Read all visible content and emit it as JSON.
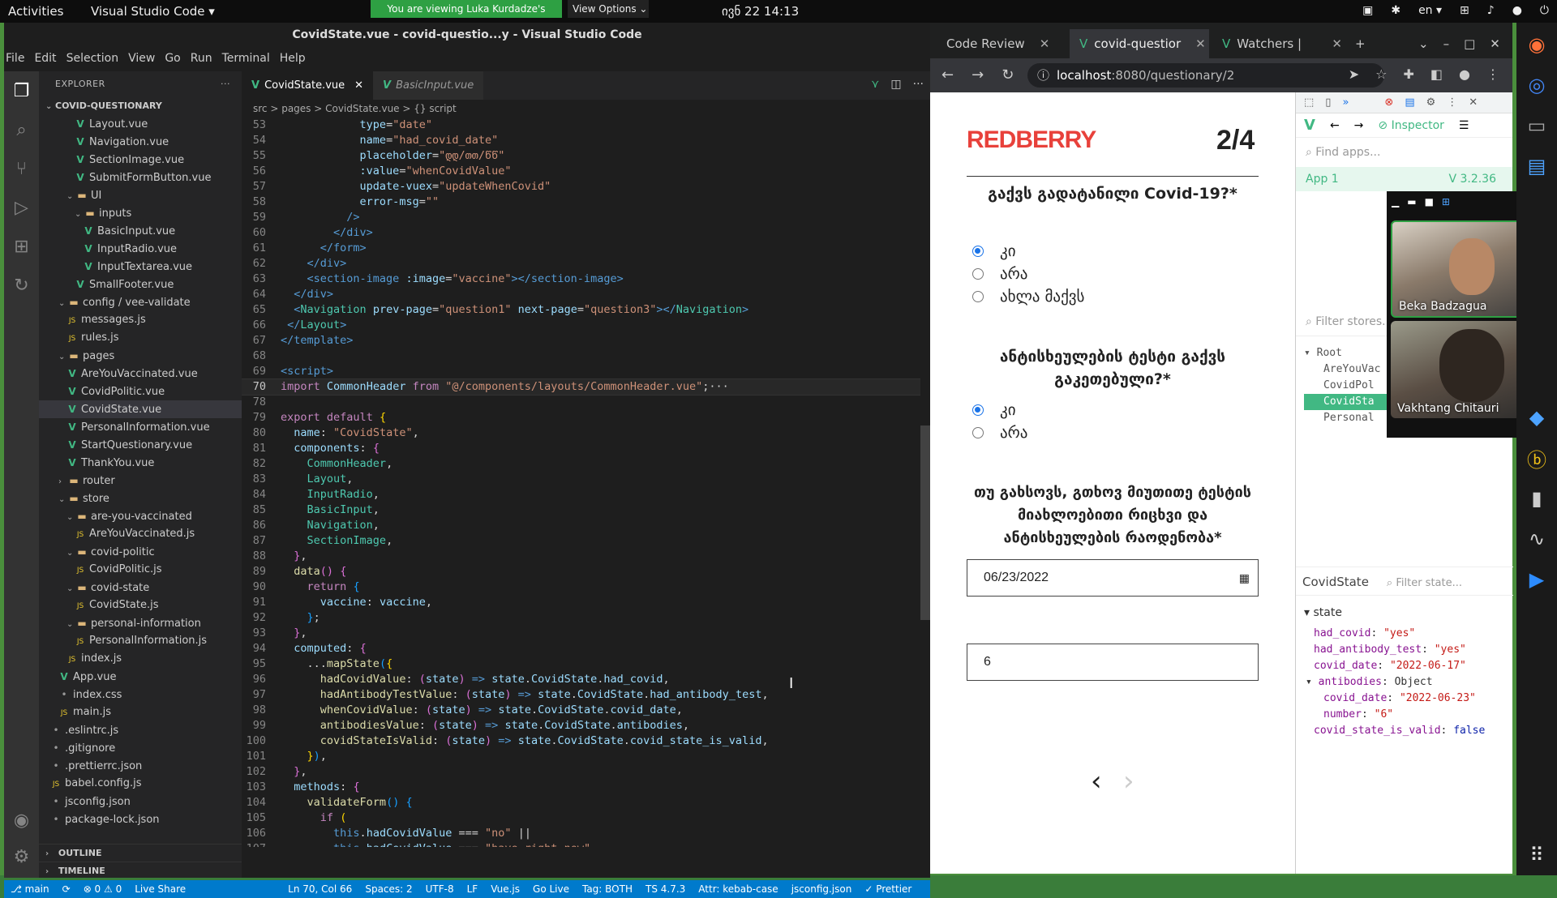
{
  "topbar": {
    "activities": "Activities",
    "app_name": "Visual Studio Code ▾",
    "share_banner": "You are viewing Luka Kurdadze's screen",
    "view_options": "View Options ⌄",
    "clock": "ივნ 22  14:13",
    "lang": "en ▾"
  },
  "vscode": {
    "title": "CovidState.vue - covid-questio...y - Visual Studio Code",
    "menu": [
      "File",
      "Edit",
      "Selection",
      "View",
      "Go",
      "Run",
      "Terminal",
      "Help"
    ],
    "explorer_label": "EXPLORER",
    "project": "COVID-QUESTIONARY",
    "tree": [
      {
        "label": "Layout.vue",
        "type": "vue",
        "indent": 4
      },
      {
        "label": "Navigation.vue",
        "type": "vue",
        "indent": 4
      },
      {
        "label": "SectionImage.vue",
        "type": "vue",
        "indent": 4
      },
      {
        "label": "SubmitFormButton.vue",
        "type": "vue",
        "indent": 4
      },
      {
        "label": "UI",
        "type": "folder",
        "indent": 3
      },
      {
        "label": "inputs",
        "type": "folder",
        "indent": 4
      },
      {
        "label": "BasicInput.vue",
        "type": "vue",
        "indent": 5
      },
      {
        "label": "InputRadio.vue",
        "type": "vue",
        "indent": 5
      },
      {
        "label": "InputTextarea.vue",
        "type": "vue",
        "indent": 5
      },
      {
        "label": "SmallFooter.vue",
        "type": "vue",
        "indent": 4
      },
      {
        "label": "config / vee-validate",
        "type": "folder",
        "indent": 2
      },
      {
        "label": "messages.js",
        "type": "js",
        "indent": 3
      },
      {
        "label": "rules.js",
        "type": "js",
        "indent": 3
      },
      {
        "label": "pages",
        "type": "folder",
        "indent": 2
      },
      {
        "label": "AreYouVaccinated.vue",
        "type": "vue",
        "indent": 3
      },
      {
        "label": "CovidPolitic.vue",
        "type": "vue",
        "indent": 3
      },
      {
        "label": "CovidState.vue",
        "type": "vue",
        "indent": 3,
        "selected": true
      },
      {
        "label": "PersonalInformation.vue",
        "type": "vue",
        "indent": 3
      },
      {
        "label": "StartQuestionary.vue",
        "type": "vue",
        "indent": 3
      },
      {
        "label": "ThankYou.vue",
        "type": "vue",
        "indent": 3
      },
      {
        "label": "router",
        "type": "folder",
        "indent": 2,
        "collapsed": true
      },
      {
        "label": "store",
        "type": "folder",
        "indent": 2
      },
      {
        "label": "are-you-vaccinated",
        "type": "folder",
        "indent": 3
      },
      {
        "label": "AreYouVaccinated.js",
        "type": "js",
        "indent": 4
      },
      {
        "label": "covid-politic",
        "type": "folder",
        "indent": 3
      },
      {
        "label": "CovidPolitic.js",
        "type": "js",
        "indent": 4
      },
      {
        "label": "covid-state",
        "type": "folder",
        "indent": 3
      },
      {
        "label": "CovidState.js",
        "type": "js",
        "indent": 4
      },
      {
        "label": "personal-information",
        "type": "folder",
        "indent": 3
      },
      {
        "label": "PersonalInformation.js",
        "type": "js",
        "indent": 4
      },
      {
        "label": "index.js",
        "type": "js",
        "indent": 3
      },
      {
        "label": "App.vue",
        "type": "vue",
        "indent": 2
      },
      {
        "label": "index.css",
        "type": "other",
        "indent": 2
      },
      {
        "label": "main.js",
        "type": "js",
        "indent": 2
      },
      {
        "label": ".eslintrc.js",
        "type": "other",
        "indent": 1
      },
      {
        "label": ".gitignore",
        "type": "other",
        "indent": 1
      },
      {
        "label": ".prettierrc.json",
        "type": "other",
        "indent": 1
      },
      {
        "label": "babel.config.js",
        "type": "js",
        "indent": 1
      },
      {
        "label": "jsconfig.json",
        "type": "other",
        "indent": 1
      },
      {
        "label": "package-lock.json",
        "type": "other",
        "indent": 1
      }
    ],
    "outline": "OUTLINE",
    "timeline": "TIMELINE",
    "tabs": [
      {
        "label": "CovidState.vue",
        "active": true
      },
      {
        "label": "BasicInput.vue",
        "active": false
      }
    ],
    "breadcrumb": "src  >  pages  >  CovidState.vue  >  {} script",
    "status": [
      "⎇ main",
      "⟳",
      "⊗ 0 ⚠ 0",
      "Live Share",
      "Ln 70, Col 66",
      "Spaces: 2",
      "UTF-8",
      "LF",
      "Vue.js",
      "Go Live",
      "Tag: BOTH",
      "TS 4.7.3",
      "Attr: kebab-case",
      "jsconfig.json",
      "✓ Prettier"
    ]
  },
  "code_lines": [
    {
      "n": "53",
      "html": "            <span class='t-attr'>type</span><span class='t-plain'>=</span><span class='t-str'>\"date\"</span>"
    },
    {
      "n": "54",
      "html": "            <span class='t-attr'>name</span><span class='t-plain'>=</span><span class='t-str'>\"had_covid_date\"</span>"
    },
    {
      "n": "55",
      "html": "            <span class='t-attr'>placeholder</span><span class='t-plain'>=</span><span class='t-str'>\"დდ/თთ/წწ\"</span>"
    },
    {
      "n": "56",
      "html": "            <span class='t-attr'>:value</span><span class='t-plain'>=</span><span class='t-str'>\"whenCovidValue\"</span>"
    },
    {
      "n": "57",
      "html": "            <span class='t-attr'>update-vuex</span><span class='t-plain'>=</span><span class='t-str'>\"updateWhenCovid\"</span>"
    },
    {
      "n": "58",
      "html": "            <span class='t-attr'>error-msg</span><span class='t-plain'>=</span><span class='t-str'>\"\"</span>"
    },
    {
      "n": "59",
      "html": "          <span class='t-tag'>/&gt;</span>"
    },
    {
      "n": "60",
      "html": "        <span class='t-tag'>&lt;/div&gt;</span>"
    },
    {
      "n": "61",
      "html": "      <span class='t-tag'>&lt;/form&gt;</span>"
    },
    {
      "n": "62",
      "html": "    <span class='t-tag'>&lt;/div&gt;</span>"
    },
    {
      "n": "63",
      "html": "    <span class='t-tag'>&lt;section-image</span> <span class='t-attr'>:image</span><span class='t-plain'>=</span><span class='t-str'>\"vaccine\"</span><span class='t-tag'>&gt;&lt;/section-image&gt;</span>"
    },
    {
      "n": "64",
      "html": "  <span class='t-tag'>&lt;/div&gt;</span>"
    },
    {
      "n": "65",
      "html": "  <span class='t-tag'>&lt;</span><span class='t-comp'>Navigation</span> <span class='t-attr'>prev-page</span><span class='t-plain'>=</span><span class='t-str'>\"question1\"</span> <span class='t-attr'>next-page</span><span class='t-plain'>=</span><span class='t-str'>\"question3\"</span><span class='t-tag'>&gt;&lt;/</span><span class='t-comp'>Navigation</span><span class='t-tag'>&gt;</span>"
    },
    {
      "n": "66",
      "html": " <span class='t-tag'>&lt;/</span><span class='t-comp'>Layout</span><span class='t-tag'>&gt;</span>"
    },
    {
      "n": "67",
      "html": "<span class='t-tag'>&lt;/template&gt;</span>"
    },
    {
      "n": "68",
      "html": ""
    },
    {
      "n": "69",
      "html": "<span class='t-tag'>&lt;script&gt;</span>"
    },
    {
      "n": "70",
      "html": "<span class='t-kw'>import</span> <span class='t-var'>CommonHeader</span> <span class='t-kw'>from</span> <span class='t-str'>\"@/components/layouts/CommonHeader.vue\"</span><span class='t-plain'>;···</span>",
      "cur": true
    },
    {
      "n": "78",
      "html": ""
    },
    {
      "n": "79",
      "html": "<span class='t-kw'>export</span> <span class='t-kw'>default</span> <span class='t-br'>{</span>"
    },
    {
      "n": "80",
      "html": "  <span class='t-var'>name</span><span class='t-plain'>: </span><span class='t-str'>\"CovidState\"</span><span class='t-plain'>,</span>"
    },
    {
      "n": "81",
      "html": "  <span class='t-var'>components</span><span class='t-plain'>: </span><span class='t-brp'>{</span>"
    },
    {
      "n": "82",
      "html": "    <span class='t-comp'>CommonHeader</span><span class='t-plain'>,</span>"
    },
    {
      "n": "83",
      "html": "    <span class='t-comp'>Layout</span><span class='t-plain'>,</span>"
    },
    {
      "n": "84",
      "html": "    <span class='t-comp'>InputRadio</span><span class='t-plain'>,</span>"
    },
    {
      "n": "85",
      "html": "    <span class='t-comp'>BasicInput</span><span class='t-plain'>,</span>"
    },
    {
      "n": "86",
      "html": "    <span class='t-comp'>Navigation</span><span class='t-plain'>,</span>"
    },
    {
      "n": "87",
      "html": "    <span class='t-comp'>SectionImage</span><span class='t-plain'>,</span>"
    },
    {
      "n": "88",
      "html": "  <span class='t-brp'>}</span><span class='t-plain'>,</span>"
    },
    {
      "n": "89",
      "html": "  <span class='t-fn'>data</span><span class='t-brp'>()</span> <span class='t-brp'>{</span>"
    },
    {
      "n": "90",
      "html": "    <span class='t-kw'>return</span> <span class='t-brb'>{</span>"
    },
    {
      "n": "91",
      "html": "      <span class='t-var'>vaccine</span><span class='t-plain'>: </span><span class='t-var'>vaccine</span><span class='t-plain'>,</span>"
    },
    {
      "n": "92",
      "html": "    <span class='t-brb'>}</span><span class='t-plain'>;</span>"
    },
    {
      "n": "93",
      "html": "  <span class='t-brp'>}</span><span class='t-plain'>,</span>"
    },
    {
      "n": "94",
      "html": "  <span class='t-var'>computed</span><span class='t-plain'>: </span><span class='t-brp'>{</span>"
    },
    {
      "n": "95",
      "html": "    <span class='t-plain'>...</span><span class='t-fn'>mapState</span><span class='t-brb'>(</span><span class='t-br'>{</span>"
    },
    {
      "n": "96",
      "html": "      <span class='t-fn'>hadCovidValue</span><span class='t-plain'>: </span><span class='t-brp'>(</span><span class='t-var'>state</span><span class='t-brp'>)</span> <span class='t-kwb'>=&gt;</span> <span class='t-var'>state</span><span class='t-plain'>.</span><span class='t-var'>CovidState</span><span class='t-plain'>.</span><span class='t-var'>had_covid</span><span class='t-plain'>,</span>"
    },
    {
      "n": "97",
      "html": "      <span class='t-fn'>hadAntibodyTestValue</span><span class='t-plain'>: </span><span class='t-brp'>(</span><span class='t-var'>state</span><span class='t-brp'>)</span> <span class='t-kwb'>=&gt;</span> <span class='t-var'>state</span><span class='t-plain'>.</span><span class='t-var'>CovidState</span><span class='t-plain'>.</span><span class='t-var'>had_antibody_test</span><span class='t-plain'>,</span>"
    },
    {
      "n": "98",
      "html": "      <span class='t-fn'>whenCovidValue</span><span class='t-plain'>: </span><span class='t-brp'>(</span><span class='t-var'>state</span><span class='t-brp'>)</span> <span class='t-kwb'>=&gt;</span> <span class='t-var'>state</span><span class='t-plain'>.</span><span class='t-var'>CovidState</span><span class='t-plain'>.</span><span class='t-var'>covid_date</span><span class='t-plain'>,</span>"
    },
    {
      "n": "99",
      "html": "      <span class='t-fn'>antibodiesValue</span><span class='t-plain'>: </span><span class='t-brp'>(</span><span class='t-var'>state</span><span class='t-brp'>)</span> <span class='t-kwb'>=&gt;</span> <span class='t-var'>state</span><span class='t-plain'>.</span><span class='t-var'>CovidState</span><span class='t-plain'>.</span><span class='t-var'>antibodies</span><span class='t-plain'>,</span>"
    },
    {
      "n": "100",
      "html": "      <span class='t-fn'>covidStateIsValid</span><span class='t-plain'>: </span><span class='t-brp'>(</span><span class='t-var'>state</span><span class='t-brp'>)</span> <span class='t-kwb'>=&gt;</span> <span class='t-var'>state</span><span class='t-plain'>.</span><span class='t-var'>CovidState</span><span class='t-plain'>.</span><span class='t-var'>covid_state_is_valid</span><span class='t-plain'>,</span>"
    },
    {
      "n": "101",
      "html": "    <span class='t-br'>}</span><span class='t-brb'>)</span><span class='t-plain'>,</span>"
    },
    {
      "n": "102",
      "html": "  <span class='t-brp'>}</span><span class='t-plain'>,</span>"
    },
    {
      "n": "103",
      "html": "  <span class='t-var'>methods</span><span class='t-plain'>: </span><span class='t-brp'>{</span>"
    },
    {
      "n": "104",
      "html": "    <span class='t-fn'>validateForm</span><span class='t-brb'>()</span> <span class='t-brb'>{</span>"
    },
    {
      "n": "105",
      "html": "      <span class='t-kw'>if</span> <span class='t-br'>(</span>"
    },
    {
      "n": "106",
      "html": "        <span class='t-kwb'>this</span><span class='t-plain'>.</span><span class='t-var'>hadCovidValue</span> <span class='t-plain'>===</span> <span class='t-str'>\"no\"</span> <span class='t-plain'>||</span>"
    },
    {
      "n": "107",
      "html": "        <span class='t-kwb'>this</span><span class='t-plain'>.</span><span class='t-var'>hadCovidValue</span> <span class='t-plain'>===</span> <span class='t-str'>\"have_right_now\"</span>"
    }
  ],
  "chrome": {
    "tabs": [
      {
        "label": "Code Review",
        "active": false
      },
      {
        "label": "covid-questior",
        "active": true
      },
      {
        "label": "Watchers | Vu",
        "active": false
      }
    ],
    "url_host": "localhost",
    "url_path": ":8080/questionary/2"
  },
  "page": {
    "logo": "REDBERRY",
    "page_num": "2/4",
    "q1": "გაქვს გადატანილი Covid-19?*",
    "q1_options": [
      "კი",
      "არა",
      "ახლა მაქვს"
    ],
    "q2": "ანტისხეულების ტესტი გაქვს გაკეთებული?*",
    "q2_options": [
      "კი",
      "არა"
    ],
    "q3": "თუ გახსოვს, გთხოვ მიუთითე ტესტის მიახლოებითი რიცხვი და ანტისხეულების რაოდენობა*",
    "date_value": "06/23/2022",
    "number_value": "6",
    "prev": "‹",
    "next": "›"
  },
  "devtools": {
    "inspector": "Inspector",
    "find_apps": "Find apps...",
    "app": "App 1",
    "version": "3.2.36",
    "filter_stores": "Filter stores...",
    "tree": [
      "Root",
      "AreYouVac",
      "CovidPol",
      "CovidSta",
      "Personal"
    ],
    "store_name": "CovidState",
    "filter_state": "Filter state...",
    "state_label": "state",
    "state": [
      {
        "k": "had_covid",
        "v": "\"yes\"",
        "indent": 1
      },
      {
        "k": "had_antibody_test",
        "v": "\"yes\"",
        "indent": 1
      },
      {
        "k": "covid_date",
        "v": "\"2022-06-17\"",
        "indent": 1
      },
      {
        "k": "antibodies",
        "v": "Object",
        "indent": 1,
        "obj": true
      },
      {
        "k": "covid_date",
        "v": "\"2022-06-23\"",
        "indent": 2
      },
      {
        "k": "number",
        "v": "\"6\"",
        "indent": 2
      },
      {
        "k": "covid_state_is_valid",
        "v": "false",
        "indent": 1,
        "bool": true
      }
    ]
  },
  "video": {
    "person1": "Beka Badzagua",
    "person2": "Vakhtang Chitauri"
  }
}
